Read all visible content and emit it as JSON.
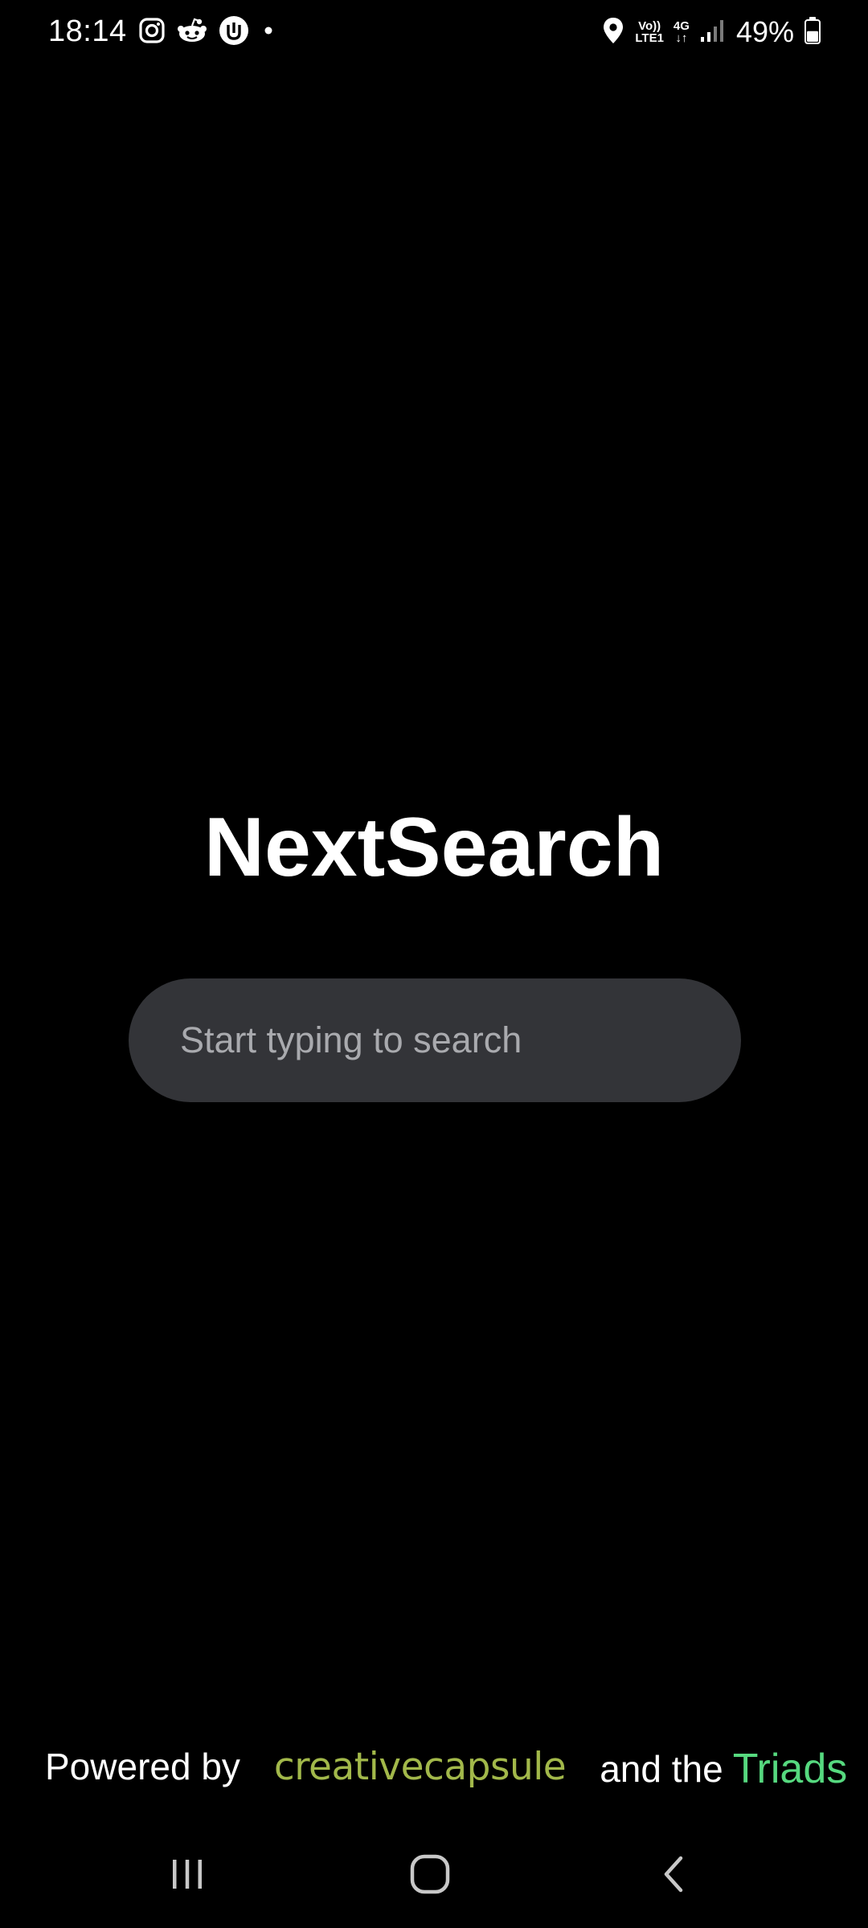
{
  "status_bar": {
    "time": "18:14",
    "notification_icons": [
      "instagram-icon",
      "reddit-icon",
      "one-ui-icon",
      "dot-icon"
    ],
    "network": {
      "volte_top": "Vo))",
      "volte_bottom": "LTE1",
      "data_top": "4G",
      "data_bottom": "↓↑"
    },
    "battery_percent": "49%",
    "battery_level": 0.49
  },
  "main": {
    "title": "NextSearch",
    "search": {
      "placeholder": "Start typing to search",
      "value": ""
    }
  },
  "footer": {
    "prefix": "Powered by",
    "brand": "creativecapsule",
    "middle": "and the",
    "team": "Triads"
  },
  "nav_bar": {
    "recents": "recents-icon",
    "home": "home-icon",
    "back": "back-icon"
  },
  "colors": {
    "background": "#000000",
    "search_bg": "#333438",
    "placeholder": "#a9aaae",
    "brand": "#a2b84a",
    "team": "#56d97f"
  }
}
